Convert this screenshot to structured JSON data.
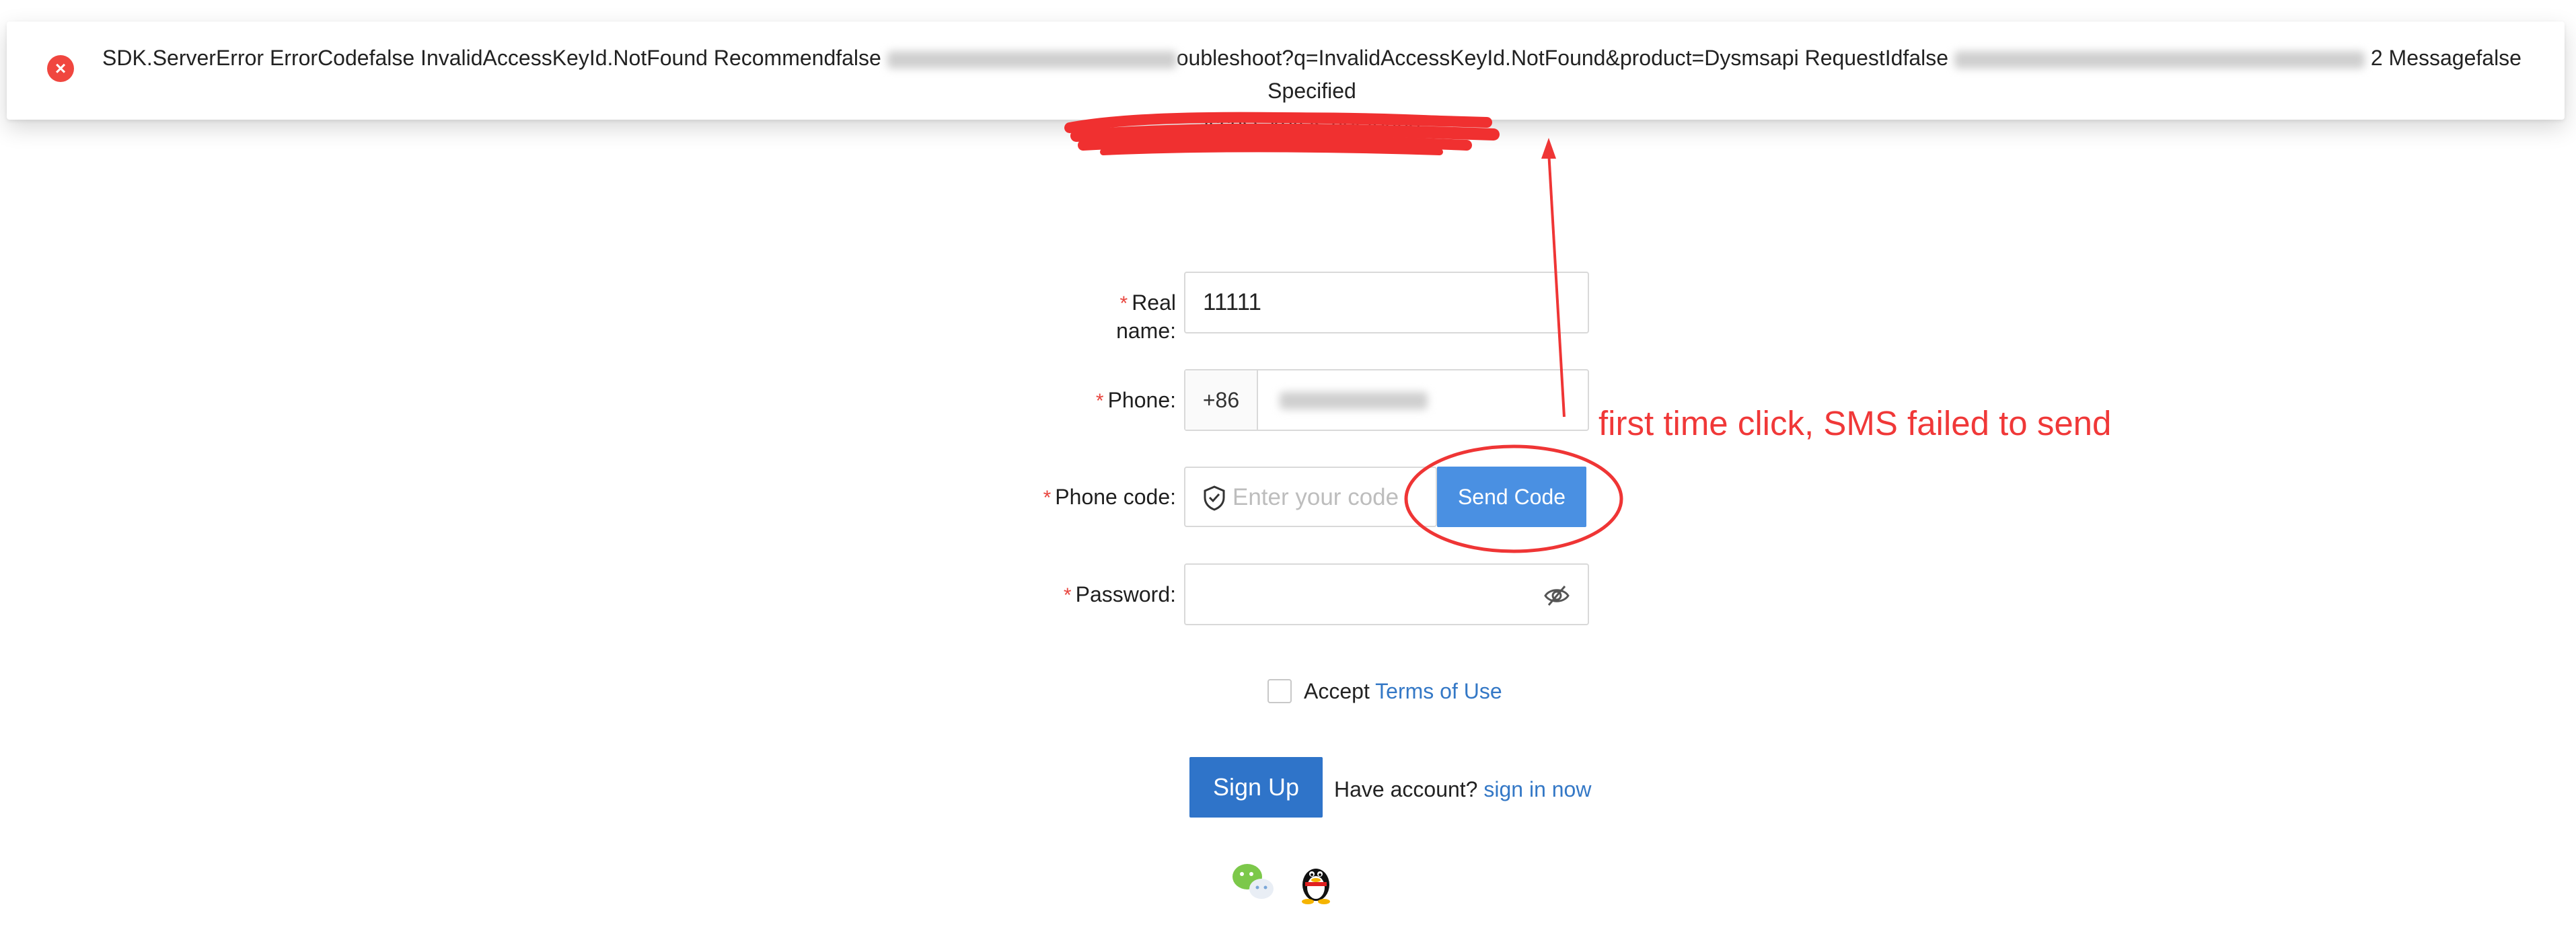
{
  "error_banner": {
    "line1_a": "SDK.ServerError ErrorCodefalse InvalidAccessKeyId.NotFound Recommendfalse",
    "line1_b": "oubleshoot?q=InvalidAccessKeyId.NotFound&product=Dysmsapi RequestIdfalse",
    "line1_c": "2 Messagefalse Specified",
    "line2": "access key is not found.",
    "icon": "error-circle-icon",
    "color": "#f0463f"
  },
  "form": {
    "real_name": {
      "label": "Real name:",
      "value": "11111"
    },
    "phone": {
      "label": "Phone:",
      "prefix": "+86"
    },
    "phone_code": {
      "label": "Phone code:",
      "placeholder": "Enter your code",
      "button": "Send Code"
    },
    "password": {
      "label": "Password:"
    },
    "required_mark": "*",
    "accept_text": "Accept",
    "terms_link": "Terms of Use",
    "signup_button": "Sign Up",
    "have_account": "Have account?",
    "signin_link": "sign in now"
  },
  "social": {
    "icons": [
      "wechat-icon",
      "qq-icon"
    ]
  },
  "annotation": {
    "text": "first time click, SMS failed to send",
    "color": "#f03838"
  },
  "colors": {
    "primary": "#2f74c9",
    "send_button": "#4a90e2",
    "link": "#3478c6",
    "required": "#e8463f"
  }
}
